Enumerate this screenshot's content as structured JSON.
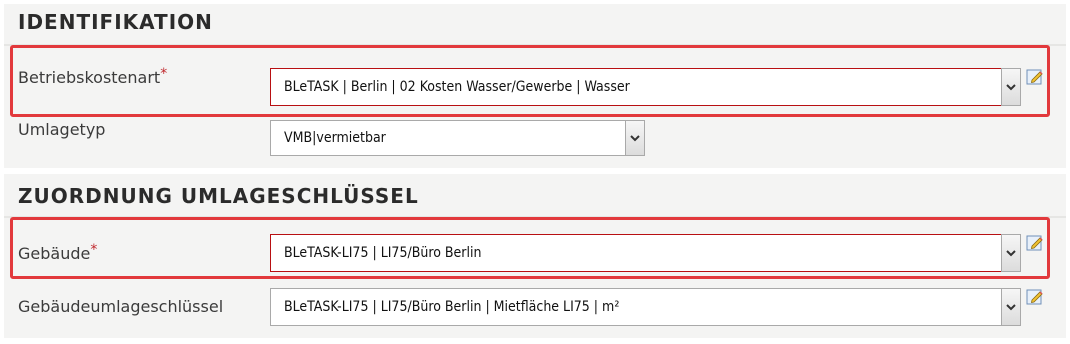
{
  "sections": {
    "identifikation": {
      "title": "IDENTIFIKATION",
      "betriebskostenart": {
        "label": "Betriebskostenart",
        "required_mark": "*",
        "value": "BLeTASK | Berlin | 02 Kosten Wasser/Gewerbe | Wasser"
      },
      "umlagetyp": {
        "label": "Umlagetyp",
        "value": "VMB|vermietbar"
      }
    },
    "zuordnung": {
      "title": "ZUORDNUNG UMLAGESCHLÜSSEL",
      "gebaeude": {
        "label": "Gebäude",
        "required_mark": "*",
        "value": "BLeTASK-LI75 | LI75/Büro Berlin"
      },
      "gebaeudeumlageschluessel": {
        "label": "Gebäudeumlageschlüssel",
        "value": "BLeTASK-LI75 | LI75/Büro Berlin | Mietfläche LI75 | m²"
      }
    }
  },
  "icons": {
    "dropdown": "chevron-down-icon",
    "edit": "edit-pencil-icon"
  },
  "colors": {
    "required": "#c0282d",
    "highlight": "#e2393c",
    "invalid_border": "#b80f12",
    "section_bg": "#f4f4f3"
  }
}
